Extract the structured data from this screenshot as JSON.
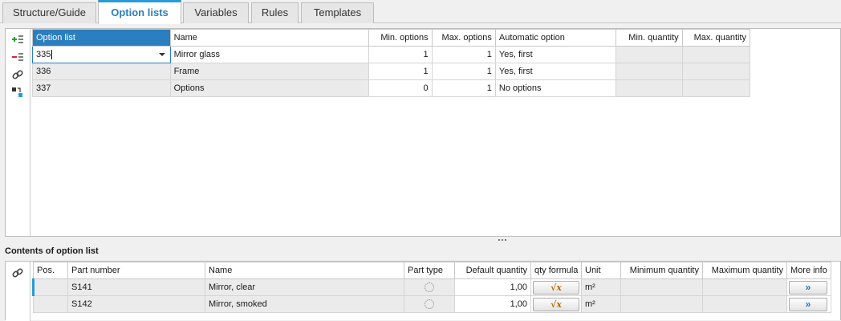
{
  "tabs": [
    {
      "label": "Structure/Guide"
    },
    {
      "label": "Option lists"
    },
    {
      "label": "Variables"
    },
    {
      "label": "Rules"
    },
    {
      "label": "Templates"
    }
  ],
  "option_lists": {
    "headers": [
      "Option list",
      "Name",
      "Min. options",
      "Max. options",
      "Automatic option",
      "Min. quantity",
      "Max. quantity"
    ],
    "rows": [
      {
        "id": "335",
        "name": "Mirror glass",
        "min": "1",
        "max": "1",
        "auto": "Yes, first",
        "min_qty": "",
        "max_qty": ""
      },
      {
        "id": "336",
        "name": "Frame",
        "min": "1",
        "max": "1",
        "auto": "Yes, first",
        "min_qty": "",
        "max_qty": ""
      },
      {
        "id": "337",
        "name": "Options",
        "min": "0",
        "max": "1",
        "auto": "No options",
        "min_qty": "",
        "max_qty": ""
      }
    ]
  },
  "contents": {
    "title": "Contents of option list",
    "headers": [
      "Pos.",
      "Part number",
      "Name",
      "Part type",
      "Default quantity",
      "qty formula",
      "Unit",
      "Minimum quantity",
      "Maximum quantity",
      "More info"
    ],
    "rows": [
      {
        "pos": "",
        "part": "S141",
        "name": "Mirror, clear",
        "default_qty": "1,00",
        "formula": "√x",
        "unit": "m²",
        "min_qty": "",
        "max_qty": "",
        "more": "»"
      },
      {
        "pos": "",
        "part": "S142",
        "name": "Mirror, smoked",
        "default_qty": "1,00",
        "formula": "√x",
        "unit": "m²",
        "min_qty": "",
        "max_qty": "",
        "more": "»"
      }
    ]
  },
  "colors": {
    "accent": "#2a9ad8",
    "selected_header": "#2a7fc1"
  }
}
